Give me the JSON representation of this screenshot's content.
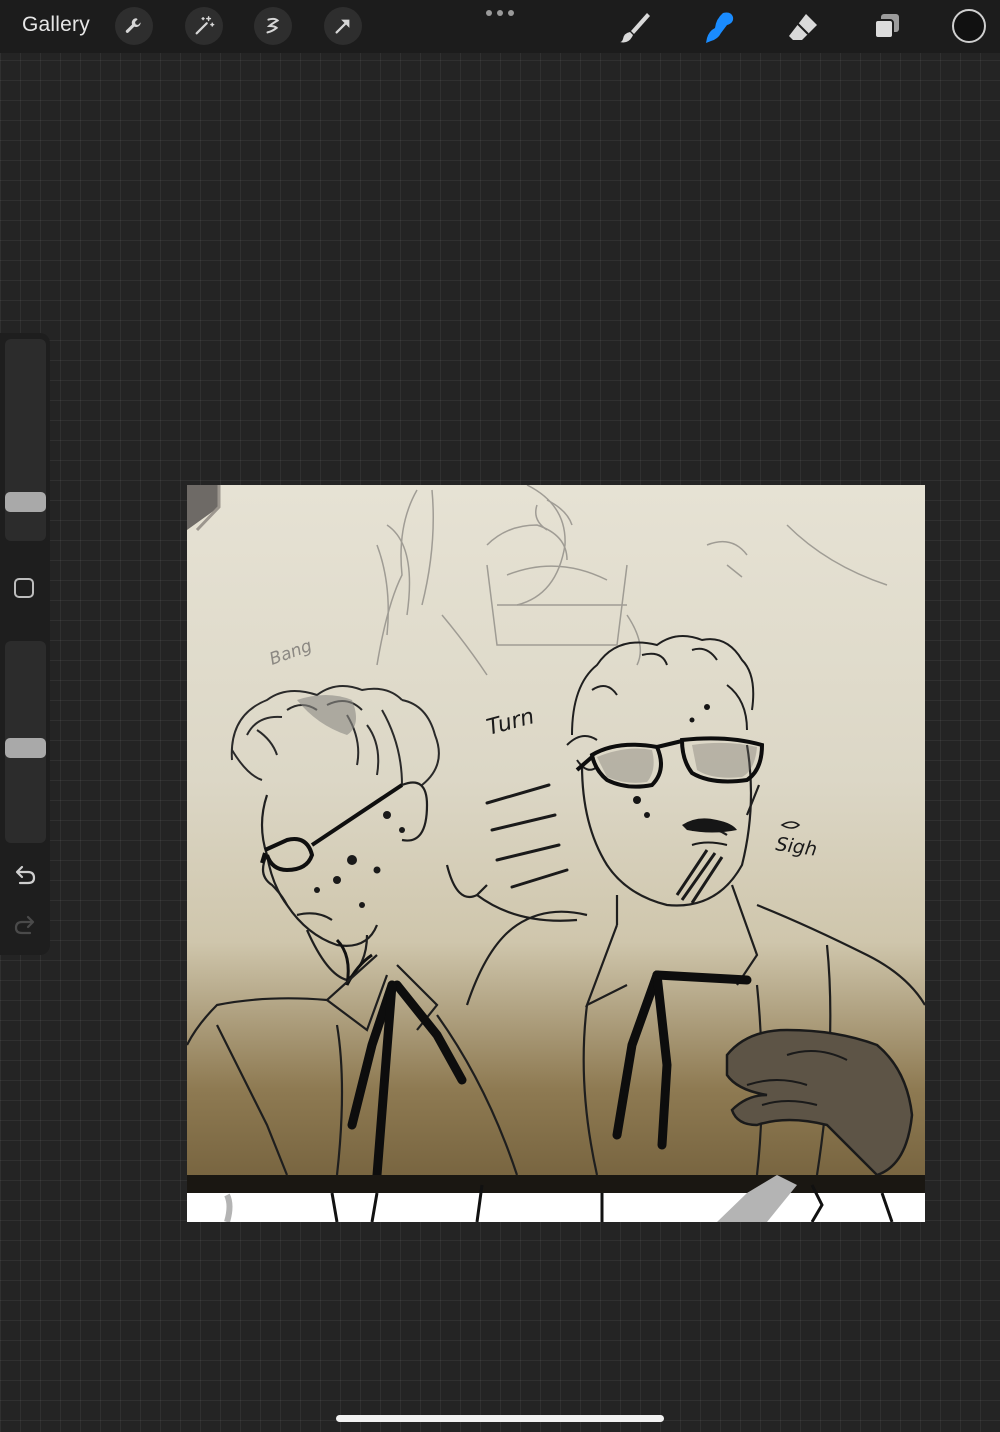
{
  "topbar": {
    "gallery_label": "Gallery",
    "icons": [
      "wrench-icon",
      "magic-wand-icon",
      "selection-icon",
      "transform-arrow-icon",
      "more-dots-icon",
      "brush-icon",
      "smudge-icon",
      "eraser-icon",
      "layers-icon",
      "color-icon"
    ],
    "active_tool": "smudge",
    "active_color": "#1a8cff",
    "current_color": "#111111"
  },
  "sidebar": {
    "brush_size_level": 0.25,
    "opacity_level": 0.47,
    "icons": [
      "modify-square-icon",
      "undo-icon",
      "redo-icon"
    ]
  },
  "canvas": {
    "annotations": {
      "turn": "Turn",
      "sigh": "Sigh",
      "bang": "Bang"
    }
  }
}
